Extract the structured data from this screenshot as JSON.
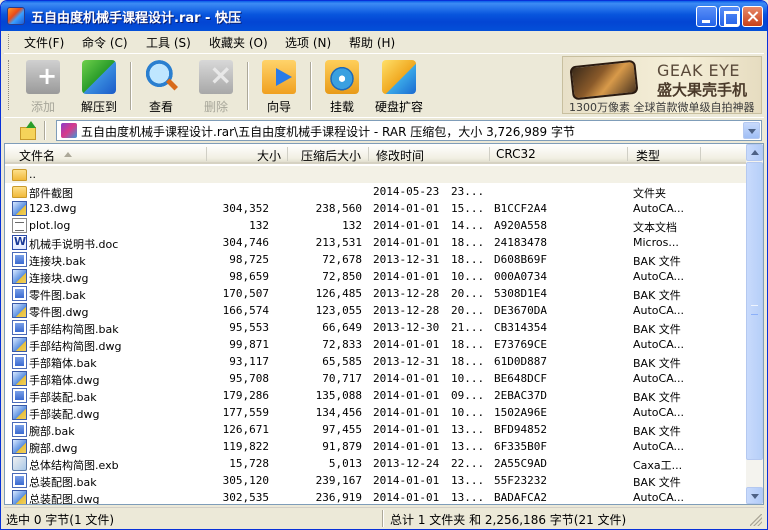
{
  "window": {
    "title": "五自由度机械手课程设计.rar - 快压"
  },
  "menu": [
    {
      "label": "文件(F)"
    },
    {
      "label": "命令 (C)"
    },
    {
      "label": "工具 (S)"
    },
    {
      "label": "收藏夹 (O)"
    },
    {
      "label": "选项 (N)"
    },
    {
      "label": "帮助 (H)"
    }
  ],
  "toolbar": {
    "buttons": [
      {
        "label": "添加",
        "icon": "add-icon",
        "enabled": false
      },
      {
        "label": "解压到",
        "icon": "extract-icon",
        "enabled": true
      },
      {
        "label": "查看",
        "icon": "view-icon",
        "enabled": true
      },
      {
        "label": "删除",
        "icon": "delete-icon",
        "enabled": false
      },
      {
        "label": "向导",
        "icon": "wizard-icon",
        "enabled": true
      },
      {
        "label": "挂载",
        "icon": "mount-icon",
        "enabled": true
      },
      {
        "label": "硬盘扩容",
        "icon": "disk-expand-icon",
        "enabled": true
      }
    ]
  },
  "ad": {
    "brand": "GEAK EYE",
    "slogan": "盛大果壳手机",
    "tagline": "1300万像素 全球首款微单级自拍神器"
  },
  "address": {
    "path": "五自由度机械手课程设计.rar\\五自由度机械手课程设计 - RAR 压缩包，大小 3,726,989 字节"
  },
  "columns": {
    "name": "文件名",
    "size": "大小",
    "packed": "压缩后大小",
    "modified": "修改时间",
    "crc": "CRC32",
    "type": "类型"
  },
  "files": [
    {
      "name": "..",
      "size": "",
      "packed": "",
      "date": "",
      "time": "",
      "crc": "",
      "type": "",
      "icon": "folder-icon"
    },
    {
      "name": "部件截图",
      "size": "",
      "packed": "",
      "date": "2014-05-23",
      "time": "23...",
      "crc": "",
      "type": "文件夹",
      "icon": "folder-icon"
    },
    {
      "name": "123.dwg",
      "size": "304,352",
      "packed": "238,560",
      "date": "2014-01-01",
      "time": "15...",
      "crc": "B1CCF2A4",
      "type": "AutoCA...",
      "icon": "dwg-icon"
    },
    {
      "name": "plot.log",
      "size": "132",
      "packed": "132",
      "date": "2014-01-01",
      "time": "14...",
      "crc": "A920A558",
      "type": "文本文档",
      "icon": "log-icon"
    },
    {
      "name": "机械手说明书.doc",
      "size": "304,746",
      "packed": "213,531",
      "date": "2014-01-01",
      "time": "18...",
      "crc": "24183478",
      "type": "Micros...",
      "icon": "doc-icon"
    },
    {
      "name": "连接块.bak",
      "size": "98,725",
      "packed": "72,678",
      "date": "2013-12-31",
      "time": "18...",
      "crc": "D608B69F",
      "type": "BAK 文件",
      "icon": "bak-icon"
    },
    {
      "name": "连接块.dwg",
      "size": "98,659",
      "packed": "72,850",
      "date": "2014-01-01",
      "time": "10...",
      "crc": "000A0734",
      "type": "AutoCA...",
      "icon": "dwg-icon"
    },
    {
      "name": "零件图.bak",
      "size": "170,507",
      "packed": "126,485",
      "date": "2013-12-28",
      "time": "20...",
      "crc": "5308D1E4",
      "type": "BAK 文件",
      "icon": "bak-icon"
    },
    {
      "name": "零件图.dwg",
      "size": "166,574",
      "packed": "123,055",
      "date": "2013-12-28",
      "time": "20...",
      "crc": "DE3670DA",
      "type": "AutoCA...",
      "icon": "dwg-icon"
    },
    {
      "name": "手部结构简图.bak",
      "size": "95,553",
      "packed": "66,649",
      "date": "2013-12-30",
      "time": "21...",
      "crc": "CB314354",
      "type": "BAK 文件",
      "icon": "bak-icon"
    },
    {
      "name": "手部结构简图.dwg",
      "size": "99,871",
      "packed": "72,833",
      "date": "2014-01-01",
      "time": "18...",
      "crc": "E73769CE",
      "type": "AutoCA...",
      "icon": "dwg-icon"
    },
    {
      "name": "手部箱体.bak",
      "size": "93,117",
      "packed": "65,585",
      "date": "2013-12-31",
      "time": "18...",
      "crc": "61D0D887",
      "type": "BAK 文件",
      "icon": "bak-icon"
    },
    {
      "name": "手部箱体.dwg",
      "size": "95,708",
      "packed": "70,717",
      "date": "2014-01-01",
      "time": "10...",
      "crc": "BE648DCF",
      "type": "AutoCA...",
      "icon": "dwg-icon"
    },
    {
      "name": "手部装配.bak",
      "size": "179,286",
      "packed": "135,088",
      "date": "2014-01-01",
      "time": "09...",
      "crc": "2EBAC37D",
      "type": "BAK 文件",
      "icon": "bak-icon"
    },
    {
      "name": "手部装配.dwg",
      "size": "177,559",
      "packed": "134,456",
      "date": "2014-01-01",
      "time": "10...",
      "crc": "1502A96E",
      "type": "AutoCA...",
      "icon": "dwg-icon"
    },
    {
      "name": "腕部.bak",
      "size": "126,671",
      "packed": "97,455",
      "date": "2014-01-01",
      "time": "13...",
      "crc": "BFD94852",
      "type": "BAK 文件",
      "icon": "bak-icon"
    },
    {
      "name": "腕部.dwg",
      "size": "119,822",
      "packed": "91,879",
      "date": "2014-01-01",
      "time": "13...",
      "crc": "6F335B0F",
      "type": "AutoCA...",
      "icon": "dwg-icon"
    },
    {
      "name": "总体结构简图.exb",
      "size": "15,728",
      "packed": "5,013",
      "date": "2013-12-24",
      "time": "22...",
      "crc": "2A55C9AD",
      "type": "Caxa工...",
      "icon": "exb-icon"
    },
    {
      "name": "总装配图.bak",
      "size": "305,120",
      "packed": "239,167",
      "date": "2014-01-01",
      "time": "13...",
      "crc": "55F23232",
      "type": "BAK 文件",
      "icon": "bak-icon"
    },
    {
      "name": "总装配图.dwg",
      "size": "302,535",
      "packed": "236,919",
      "date": "2014-01-01",
      "time": "13...",
      "crc": "BADAFCA2",
      "type": "AutoCA...",
      "icon": "dwg-icon"
    }
  ],
  "status": {
    "selection": "选中  0 字节(1 文件)",
    "total": "总计 1 文件夹 和  2,256,186 字节(21 文件)"
  }
}
